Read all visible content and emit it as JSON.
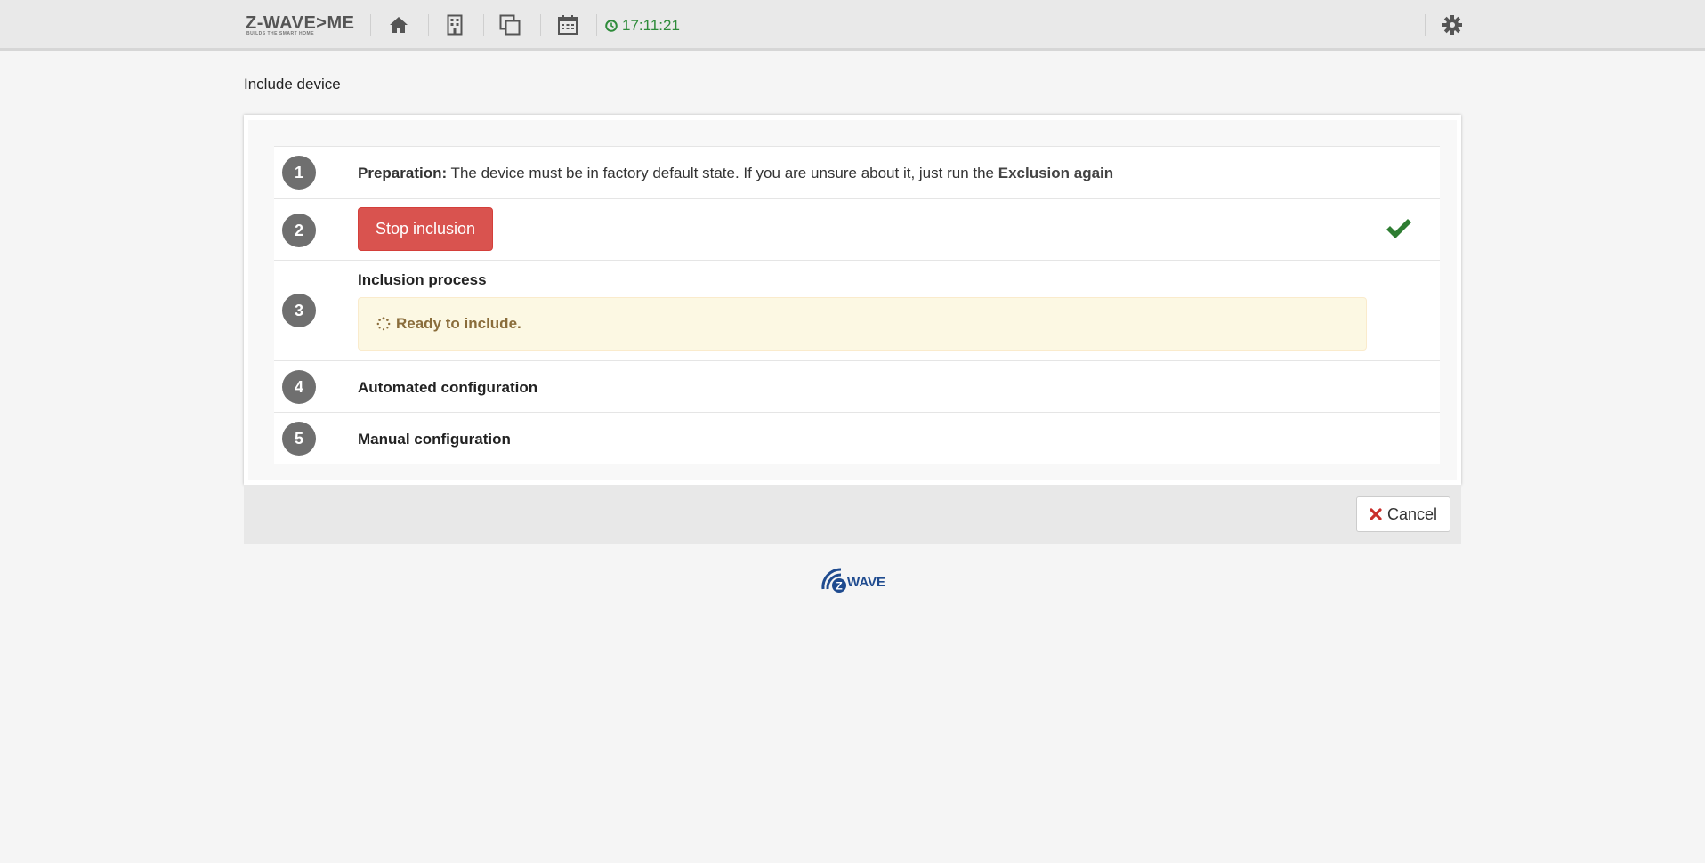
{
  "header": {
    "brand_name": "Z-WAVE>ME",
    "brand_tagline": "BUILDS THE SMART HOME",
    "nav_icons": [
      "home-icon",
      "building-icon",
      "copy-icon",
      "calendar-icon"
    ],
    "clock": "17:11:21",
    "settings_icon": "gear-icon"
  },
  "page": {
    "title": "Include device"
  },
  "steps": [
    {
      "number": "1",
      "label_bold": "Preparation:",
      "text": " The device must be in factory default state. If you are unsure about it, just run the ",
      "link_text": "Exclusion again"
    },
    {
      "number": "2",
      "button_label": "Stop inclusion",
      "status_icon": "check-icon"
    },
    {
      "number": "3",
      "title": "Inclusion process",
      "alert_text": "Ready to include."
    },
    {
      "number": "4",
      "title": "Automated configuration"
    },
    {
      "number": "5",
      "title": "Manual configuration"
    }
  ],
  "footer": {
    "cancel_label": "Cancel"
  },
  "logo": {
    "text": "WAVE",
    "badge": "Z"
  },
  "colors": {
    "danger": "#d9534f",
    "success": "#2e7d32",
    "clock": "#2e8b3a",
    "step_badge": "#6f6f6f",
    "alert_bg": "#fcf8e3",
    "alert_text": "#8a6d3b",
    "logo": "#1f4b8f"
  }
}
